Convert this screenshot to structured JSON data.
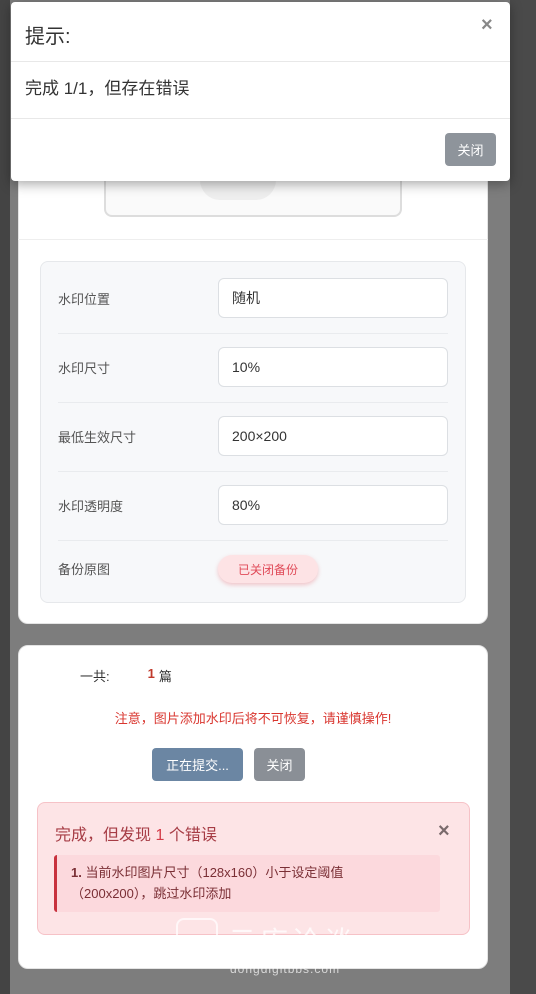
{
  "tip_dialog": {
    "title": "提示:",
    "message": "完成 1/1，但存在错误",
    "close_symbol": "×",
    "close_button": "关闭"
  },
  "settings": {
    "rows": [
      {
        "label": "水印位置",
        "value": "随机"
      },
      {
        "label": "水印尺寸",
        "value": "10%"
      },
      {
        "label": "最低生效尺寸",
        "value": "200×200"
      },
      {
        "label": "水印透明度",
        "value": "80%"
      }
    ],
    "backup": {
      "label": "备份原图",
      "badge": "已关闭备份"
    }
  },
  "submit_panel": {
    "total_label": "一共:",
    "total_count": "1",
    "total_unit": "篇",
    "warning": "注意，图片添加水印后将不可恢复，请谨慎操作!",
    "submitting_button": "正在提交...",
    "close_button": "关闭"
  },
  "alert": {
    "title_prefix": "完成，但发现",
    "error_count": "1",
    "title_suffix": "个错误",
    "close_symbol": "×",
    "item_number": "1.",
    "item_text_line1": "当前水印图片尺寸（128x160）小于设定阈值",
    "item_text_line2": "（200x200），跳过水印添加"
  },
  "watermark": {
    "text": "云库论谈",
    "url": "dongdigitbbs.com"
  }
}
